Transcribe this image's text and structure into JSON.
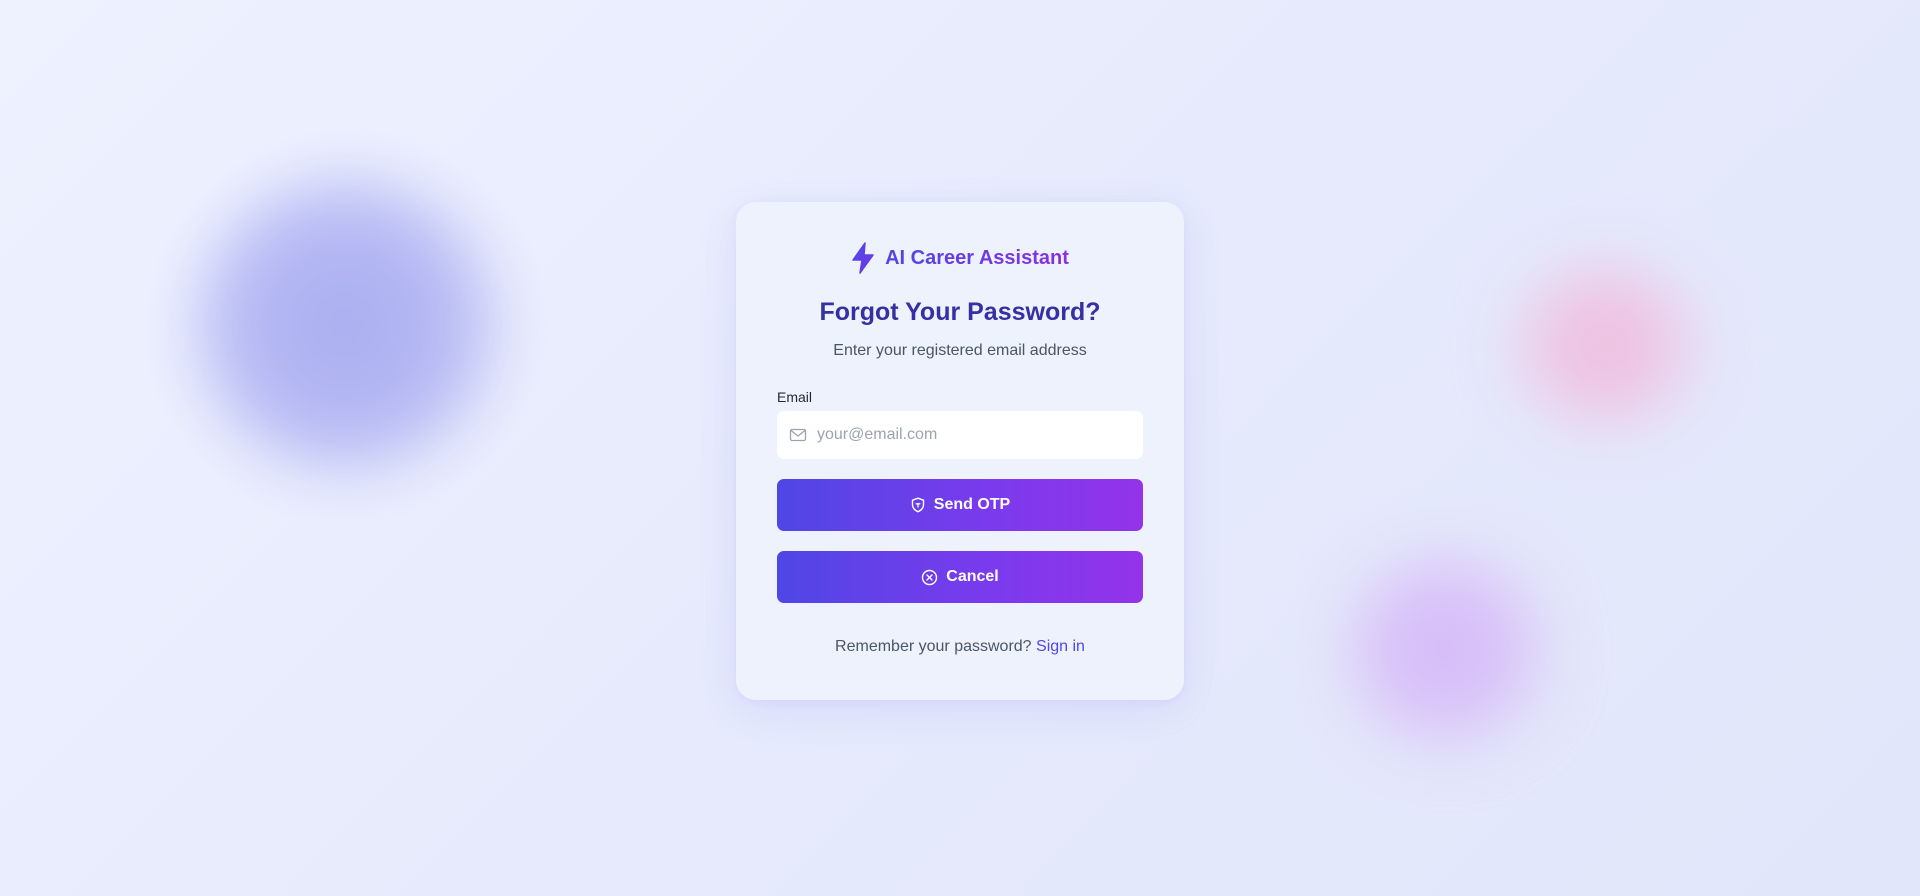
{
  "brand": {
    "name": "AI Career Assistant",
    "icon": "lightning-bolt-icon"
  },
  "heading": {
    "title": "Forgot Your Password?",
    "subtitle": "Enter your registered email address"
  },
  "form": {
    "email_label": "Email",
    "email_placeholder": "your@email.com",
    "email_value": "",
    "email_icon": "mail-icon"
  },
  "buttons": {
    "send_otp": {
      "label": "Send OTP",
      "icon": "shield-icon"
    },
    "cancel": {
      "label": "Cancel",
      "icon": "close-circle-icon"
    }
  },
  "footer": {
    "prompt": "Remember your password?",
    "link": "Sign in"
  },
  "colors": {
    "accent": "#4f46e5",
    "accent_end": "#9333ea",
    "title": "#3730a3",
    "background": "#e8ecfc"
  }
}
